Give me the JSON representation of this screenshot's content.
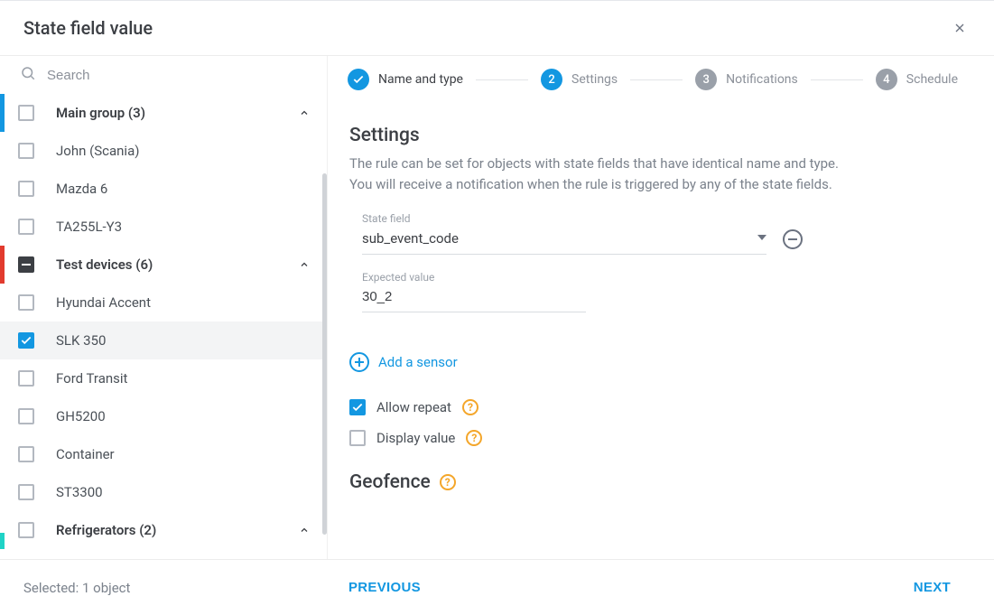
{
  "title": "State field value",
  "search": {
    "placeholder": "Search"
  },
  "sidebar": {
    "items": [
      {
        "label": "Main group (3)",
        "type": "group",
        "check": "empty",
        "expand": true,
        "accent": "#1397e1"
      },
      {
        "label": "John (Scania)",
        "type": "item",
        "check": "empty"
      },
      {
        "label": "Mazda 6",
        "type": "item",
        "check": "empty"
      },
      {
        "label": "TA255L-Y3",
        "type": "item",
        "check": "empty"
      },
      {
        "label": "Test devices (6)",
        "type": "group",
        "check": "indet",
        "expand": true,
        "accent": "#e23b2e"
      },
      {
        "label": "Hyundai Accent",
        "type": "item",
        "check": "empty"
      },
      {
        "label": "SLK 350",
        "type": "item",
        "check": "checked",
        "selected": true
      },
      {
        "label": "Ford Transit",
        "type": "item",
        "check": "empty"
      },
      {
        "label": "GH5200",
        "type": "item",
        "check": "empty"
      },
      {
        "label": "Container",
        "type": "item",
        "check": "empty"
      },
      {
        "label": "ST3300",
        "type": "item",
        "check": "empty"
      },
      {
        "label": "Refrigerators (2)",
        "type": "group",
        "check": "empty",
        "expand": true,
        "accent": "#1fd3c6",
        "partial": true
      }
    ]
  },
  "stepper": [
    {
      "label": "Name and type",
      "state": "done"
    },
    {
      "label": "Settings",
      "state": "active",
      "num": "2"
    },
    {
      "label": "Notifications",
      "state": "pending",
      "num": "3"
    },
    {
      "label": "Schedule",
      "state": "pending",
      "num": "4"
    }
  ],
  "settings": {
    "heading": "Settings",
    "desc1": "The rule can be set for objects with state fields that have identical name and type.",
    "desc2": "You will receive a notification when the rule is triggered by any of the state fields.",
    "state_field_label": "State field",
    "state_field_value": "sub_event_code",
    "expected_label": "Expected value",
    "expected_value": "30_2",
    "add_sensor": "Add a sensor",
    "allow_repeat": {
      "label": "Allow repeat",
      "checked": true
    },
    "display_value": {
      "label": "Display value",
      "checked": false
    },
    "geofence": "Geofence"
  },
  "footer": {
    "selected": "Selected: 1 object",
    "previous": "PREVIOUS",
    "next": "NEXT"
  }
}
